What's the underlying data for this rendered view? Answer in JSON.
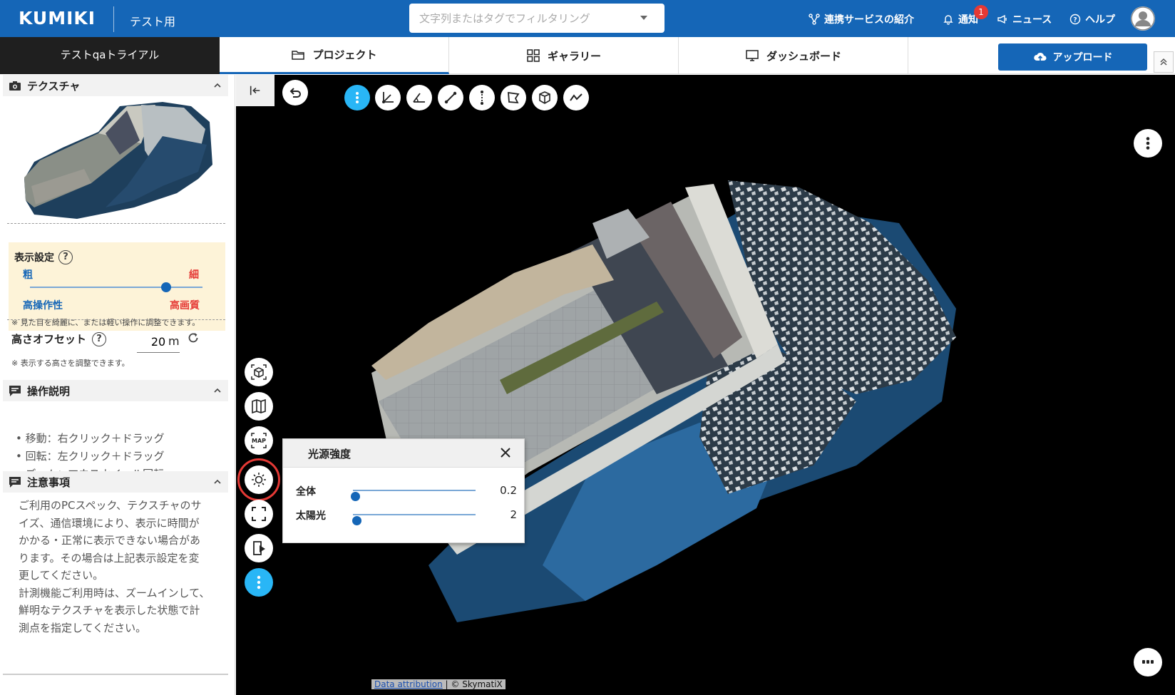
{
  "header": {
    "logo": "KUMIKI",
    "env_label": "テスト用",
    "filter_placeholder": "文字列またはタグでフィルタリング",
    "links": {
      "integrations": "連携サービスの紹介",
      "notifications": "通知",
      "notification_count": "1",
      "news": "ニュース",
      "help": "ヘルプ"
    },
    "accent_color": "#1566b7"
  },
  "tabbar": {
    "project_name": "テストqaトライアル",
    "tabs": [
      {
        "label": "プロジェクト",
        "icon": "folder-icon",
        "active": true
      },
      {
        "label": "ギャラリー",
        "icon": "grid-icon",
        "active": false
      },
      {
        "label": "ダッシュボード",
        "icon": "monitor-icon",
        "active": false
      }
    ],
    "upload_label": "アップロード"
  },
  "sidebar": {
    "texture": {
      "title": "テクスチャ"
    },
    "display": {
      "title": "表示設定",
      "coarse": "粗",
      "fine": "細",
      "performance": "高操作性",
      "quality": "高画質",
      "slider_value": 0.79,
      "note": "※ 見た目を綺麗に、または軽い操作に調整できます。"
    },
    "offset": {
      "title": "高さオフセット",
      "value": "20",
      "unit": "m",
      "note": "※ 表示する高さを調整できます。"
    },
    "operations": {
      "title": "操作説明",
      "items": [
        "移動：右クリック＋ドラッグ",
        "回転：左クリック＋ドラッグ",
        "ズーム：マウスホイール回転"
      ]
    },
    "caution": {
      "title": "注意事項",
      "lines": [
        "ご利用のPCスペック、テクスチャのサ",
        "イズ、通信環境により、表示に時間が",
        "かかる・正常に表示できない場合があ",
        "ります。その場合は上記表示設定を変",
        "更してください。",
        "計測機能ご利用時は、ズームインして、",
        "鮮明なテクスチャを表示した状態で計",
        "測点を指定してください。"
      ]
    }
  },
  "viewer": {
    "light_popup": {
      "title": "光源強度",
      "rows": [
        {
          "label": "全体",
          "value": "0.2",
          "fraction": 0.02
        },
        {
          "label": "太陽光",
          "value": "2",
          "fraction": 0.03
        }
      ]
    },
    "attribution": {
      "link": "Data attribution",
      "separator": " | ",
      "credit": "© SkymatiX"
    }
  }
}
